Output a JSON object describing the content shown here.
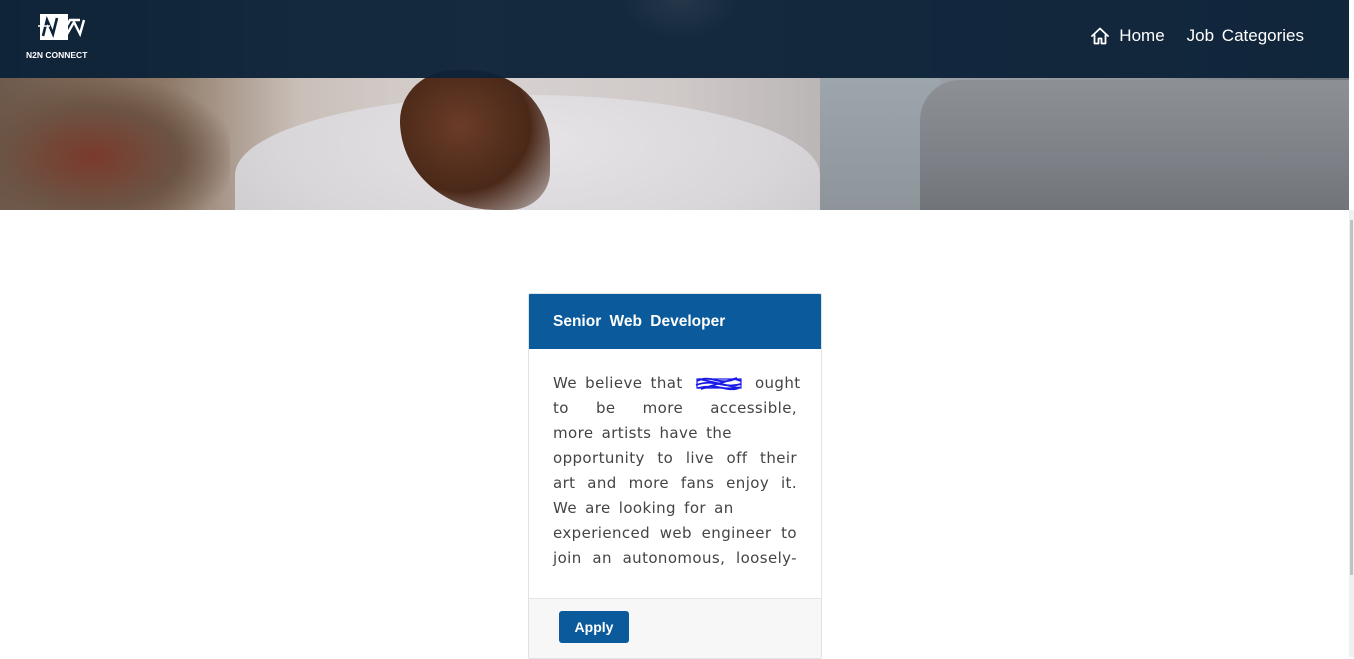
{
  "brand": {
    "logo_text": "N2N CONNECT"
  },
  "nav": {
    "home_label": "Home",
    "job_categories_label": "Job Categories"
  },
  "job_card": {
    "title": "Senior Web Developer",
    "description_lines": [
      {
        "before": "We believe that",
        "after": "ought"
      },
      "to be more accessible,",
      "more artists have the",
      "opportunity to live off their",
      "art and more fans enjoy it.",
      "We are looking for an",
      "experienced web engineer to",
      "join an autonomous, loosely-"
    ],
    "apply_label": "Apply"
  },
  "colors": {
    "navbar": "#0d2238",
    "card_header": "#0a5a9c",
    "apply_button": "#0a5a9c",
    "redaction_scribble": "#1a1ae6"
  }
}
